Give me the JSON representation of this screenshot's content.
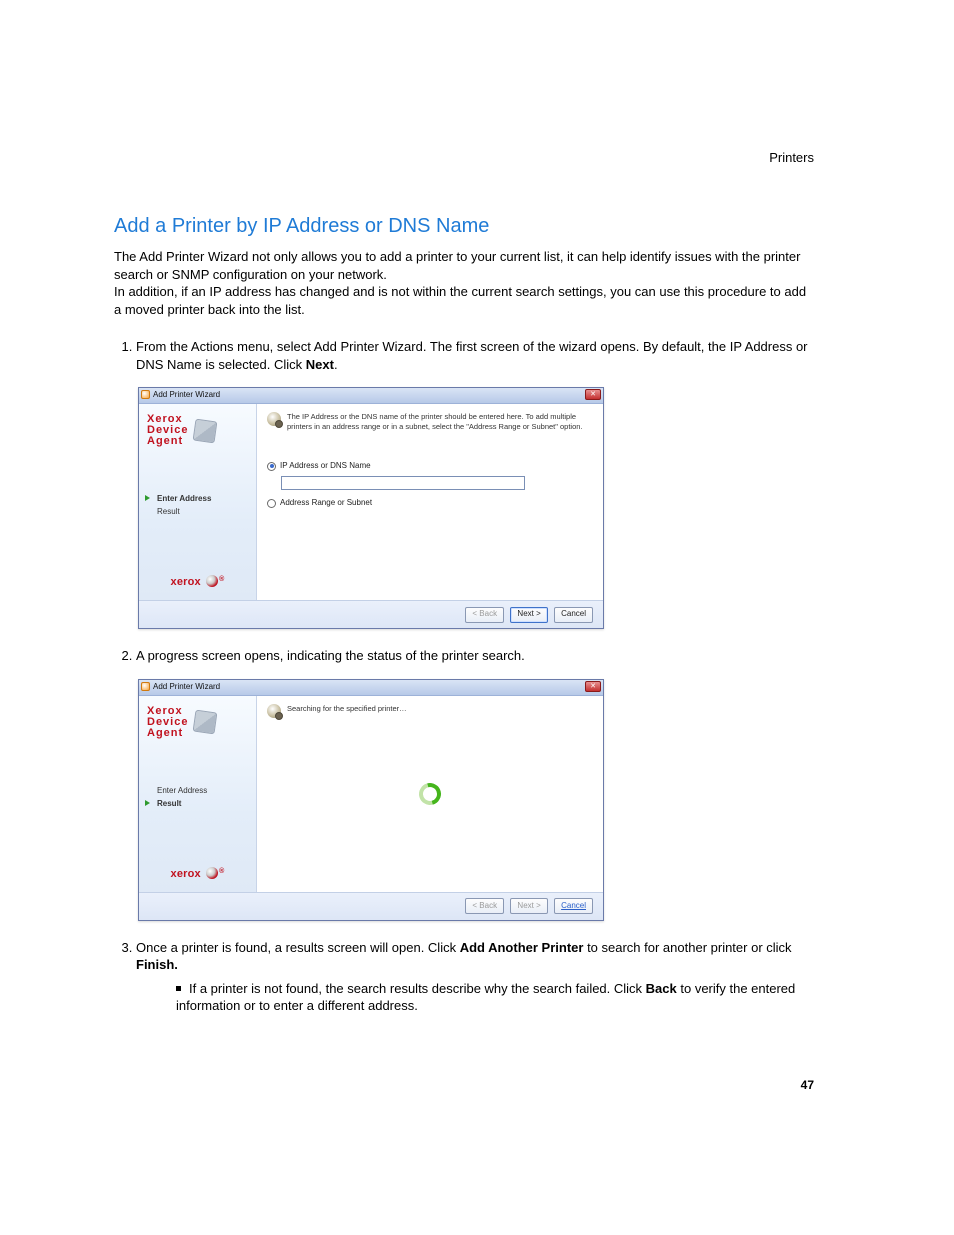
{
  "header": {
    "section": "Printers"
  },
  "title": "Add a Printer by IP Address or DNS Name",
  "intro1": "The Add Printer Wizard not only allows you to add a printer to your current list, it can help identify issues with the printer search or SNMP configuration on your network.",
  "intro2": "In addition, if an IP address has changed and is not within the current search settings, you can use this procedure to add a moved printer back into the list.",
  "step1a": "From the Actions menu, select Add Printer Wizard. The first screen of the wizard opens. By default, the IP Address or DNS Name is selected. Click ",
  "step1b": "Next",
  "step1c": ".",
  "step2": "A progress screen opens, indicating the status of the printer search.",
  "step3a": "Once a printer is found, a results screen will open. Click ",
  "step3b": "Add Another Printer",
  "step3c": " to search for another printer or click ",
  "step3d": "Finish.",
  "sub3a": "If a printer is not found, the search results describe why the search failed. Click ",
  "sub3b": "Back",
  "sub3c": " to verify the entered information or to enter a different address.",
  "pageNumber": "47",
  "wizard": {
    "title": "Add Printer Wizard",
    "brand1": "Xerox",
    "brand2": "Device",
    "brand3": "Agent",
    "sideStepEnter": "Enter Address",
    "sideStepResult": "Result",
    "footerBrand": "xerox",
    "hint": "The IP Address or the DNS name of the printer should be entered here. To add multiple printers in an address range or in a subnet, select the \"Address Range or Subnet\" option.",
    "opt1": "IP Address or DNS Name",
    "opt2": "Address Range or Subnet",
    "btnBack": "< Back",
    "btnNext": "Next >",
    "btnCancel": "Cancel",
    "searching": "Searching for the specified printer…"
  }
}
